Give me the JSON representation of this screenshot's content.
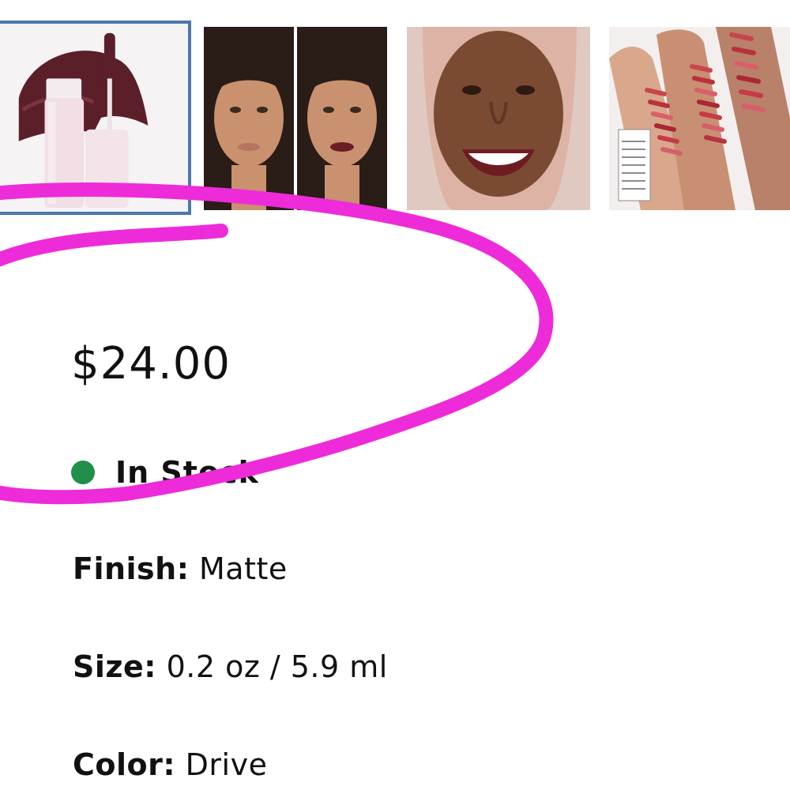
{
  "gallery": {
    "thumbnails": [
      {
        "alt": "product-tube-with-swatch",
        "selected": true
      },
      {
        "alt": "before-after-model",
        "selected": false
      },
      {
        "alt": "model-wearing-shade",
        "selected": false
      },
      {
        "alt": "arm-swatches",
        "selected": false
      }
    ],
    "selected_border_color": "#4a78ad"
  },
  "product": {
    "price": "$24.00",
    "stock_status": "In Stock",
    "stock_color": "#1f8f4a",
    "finish_label": "Finish:",
    "finish_value": " Matte",
    "size_label": "Size:",
    "size_value": " 0.2 oz / 5.9 ml",
    "color_label": "Color:",
    "color_value": " Drive"
  },
  "annotation": {
    "shape": "hand-drawn-ellipse",
    "color": "#ee2bd8"
  }
}
